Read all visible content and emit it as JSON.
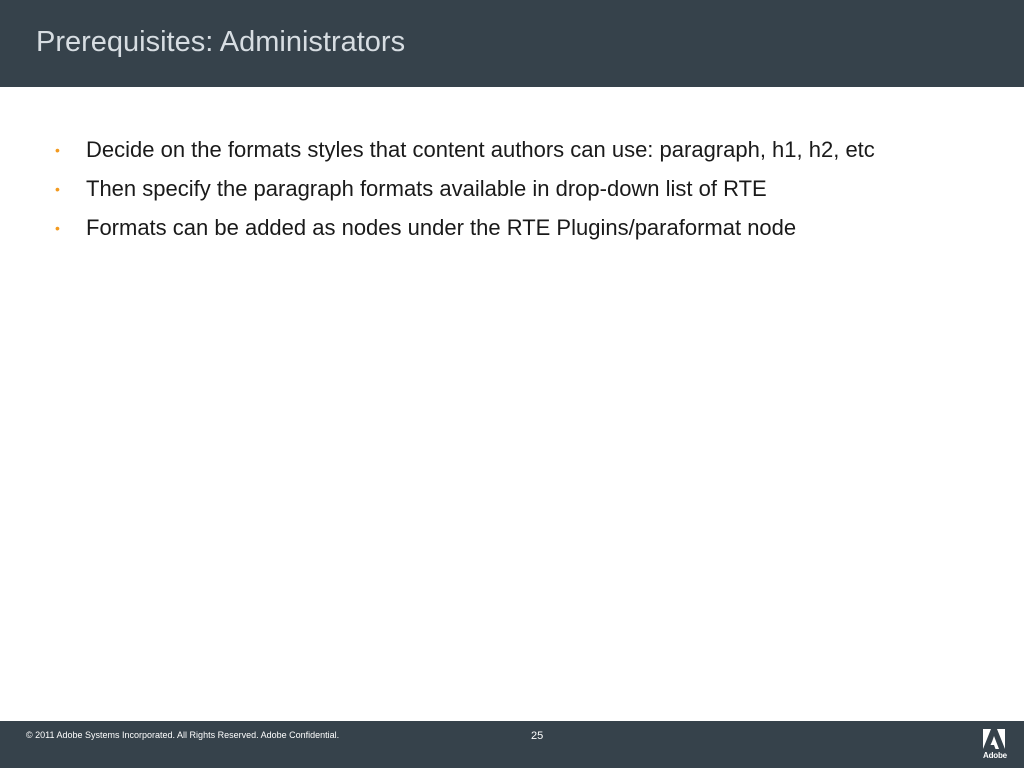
{
  "header": {
    "title": "Prerequisites: Administrators"
  },
  "bullets": [
    "Decide on the formats styles that content authors can use: paragraph, h1, h2, etc",
    "Then specify the paragraph formats available in drop-down list of RTE",
    "Formats can be added as nodes under the RTE Plugins/paraformat node"
  ],
  "bullet_glyph": "•",
  "footer": {
    "copyright": "© 2011 Adobe Systems Incorporated.  All Rights Reserved.  Adobe Confidential.",
    "page_number": "25",
    "logo_wordmark": "Adobe"
  },
  "colors": {
    "bar": "#36424b",
    "title_text": "#d7dde2",
    "bullet_accent": "#f39a1e"
  },
  "icons": {
    "logo": "adobe-logo-icon"
  }
}
